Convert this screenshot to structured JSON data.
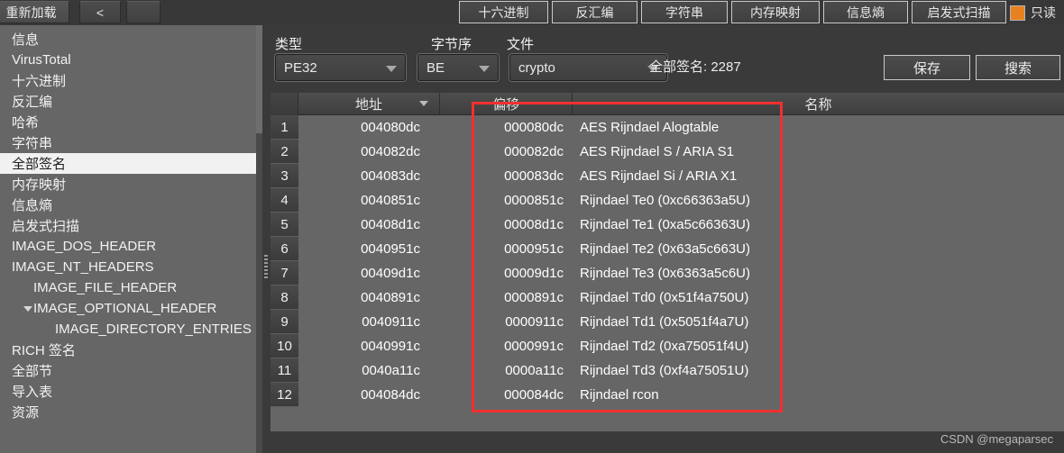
{
  "toolbar": {
    "reload_label": "重新加载",
    "back_label": "<",
    "blank_label": "",
    "hex_label": "十六进制",
    "disasm_label": "反汇编",
    "strings_label": "字符串",
    "memmap_label": "内存映射",
    "entropy_label": "信息熵",
    "heuristic_label": "启发式扫描",
    "readonly_label": "只读",
    "readonly_checked": true,
    "readonly_color": "#e8821e"
  },
  "sidebar": {
    "items": [
      {
        "label": "信息",
        "indent": 0,
        "selected": false,
        "arrow": false
      },
      {
        "label": "VirusTotal",
        "indent": 0,
        "selected": false,
        "arrow": false
      },
      {
        "label": "十六进制",
        "indent": 0,
        "selected": false,
        "arrow": false
      },
      {
        "label": "反汇编",
        "indent": 0,
        "selected": false,
        "arrow": false
      },
      {
        "label": "哈希",
        "indent": 0,
        "selected": false,
        "arrow": false
      },
      {
        "label": "字符串",
        "indent": 0,
        "selected": false,
        "arrow": false
      },
      {
        "label": "全部签名",
        "indent": 0,
        "selected": true,
        "arrow": false
      },
      {
        "label": "内存映射",
        "indent": 0,
        "selected": false,
        "arrow": false
      },
      {
        "label": "信息熵",
        "indent": 0,
        "selected": false,
        "arrow": false
      },
      {
        "label": "启发式扫描",
        "indent": 0,
        "selected": false,
        "arrow": false
      },
      {
        "label": "IMAGE_DOS_HEADER",
        "indent": 0,
        "selected": false,
        "arrow": false
      },
      {
        "label": "IMAGE_NT_HEADERS",
        "indent": 0,
        "selected": false,
        "arrow": false
      },
      {
        "label": "IMAGE_FILE_HEADER",
        "indent": 1,
        "selected": false,
        "arrow": false
      },
      {
        "label": "IMAGE_OPTIONAL_HEADER",
        "indent": 1,
        "selected": false,
        "arrow": true
      },
      {
        "label": "IMAGE_DIRECTORY_ENTRIES",
        "indent": 2,
        "selected": false,
        "arrow": false
      },
      {
        "label": "RICH 签名",
        "indent": 0,
        "selected": false,
        "arrow": false
      },
      {
        "label": "全部节",
        "indent": 0,
        "selected": false,
        "arrow": false
      },
      {
        "label": "导入表",
        "indent": 0,
        "selected": false,
        "arrow": false
      },
      {
        "label": "资源",
        "indent": 0,
        "selected": false,
        "arrow": false
      }
    ]
  },
  "controls": {
    "type_label": "类型",
    "type_value": "PE32",
    "endian_label": "字节序",
    "endian_value": "BE",
    "file_label": "文件",
    "file_value": "crypto",
    "count_text": "全部签名: 2287",
    "save_label": "保存",
    "search_label": "搜索"
  },
  "table": {
    "headers": [
      "",
      "地址",
      "偏移",
      "名称"
    ],
    "rows": [
      {
        "n": "1",
        "address": "004080dc",
        "offset": "000080dc",
        "name": "AES Rijndael Alogtable"
      },
      {
        "n": "2",
        "address": "004082dc",
        "offset": "000082dc",
        "name": "AES Rijndael S / ARIA S1"
      },
      {
        "n": "3",
        "address": "004083dc",
        "offset": "000083dc",
        "name": "AES Rijndael Si / ARIA X1"
      },
      {
        "n": "4",
        "address": "0040851c",
        "offset": "0000851c",
        "name": "Rijndael Te0 (0xc66363a5U)"
      },
      {
        "n": "5",
        "address": "00408d1c",
        "offset": "00008d1c",
        "name": "Rijndael Te1 (0xa5c66363U)"
      },
      {
        "n": "6",
        "address": "0040951c",
        "offset": "0000951c",
        "name": "Rijndael Te2 (0x63a5c663U)"
      },
      {
        "n": "7",
        "address": "00409d1c",
        "offset": "00009d1c",
        "name": "Rijndael Te3 (0x6363a5c6U)"
      },
      {
        "n": "8",
        "address": "0040891c",
        "offset": "0000891c",
        "name": "Rijndael Td0 (0x51f4a750U)"
      },
      {
        "n": "9",
        "address": "0040911c",
        "offset": "0000911c",
        "name": "Rijndael Td1 (0x5051f4a7U)"
      },
      {
        "n": "10",
        "address": "0040991c",
        "offset": "0000991c",
        "name": "Rijndael Td2 (0xa75051f4U)"
      },
      {
        "n": "11",
        "address": "0040a11c",
        "offset": "0000a11c",
        "name": "Rijndael Td3 (0xf4a75051U)"
      },
      {
        "n": "12",
        "address": "004084dc",
        "offset": "000084dc",
        "name": "Rijndael rcon"
      }
    ]
  },
  "annotation": {
    "highlight_color": "#f42f2f"
  },
  "watermark": {
    "text": "CSDN @megaparsec"
  }
}
